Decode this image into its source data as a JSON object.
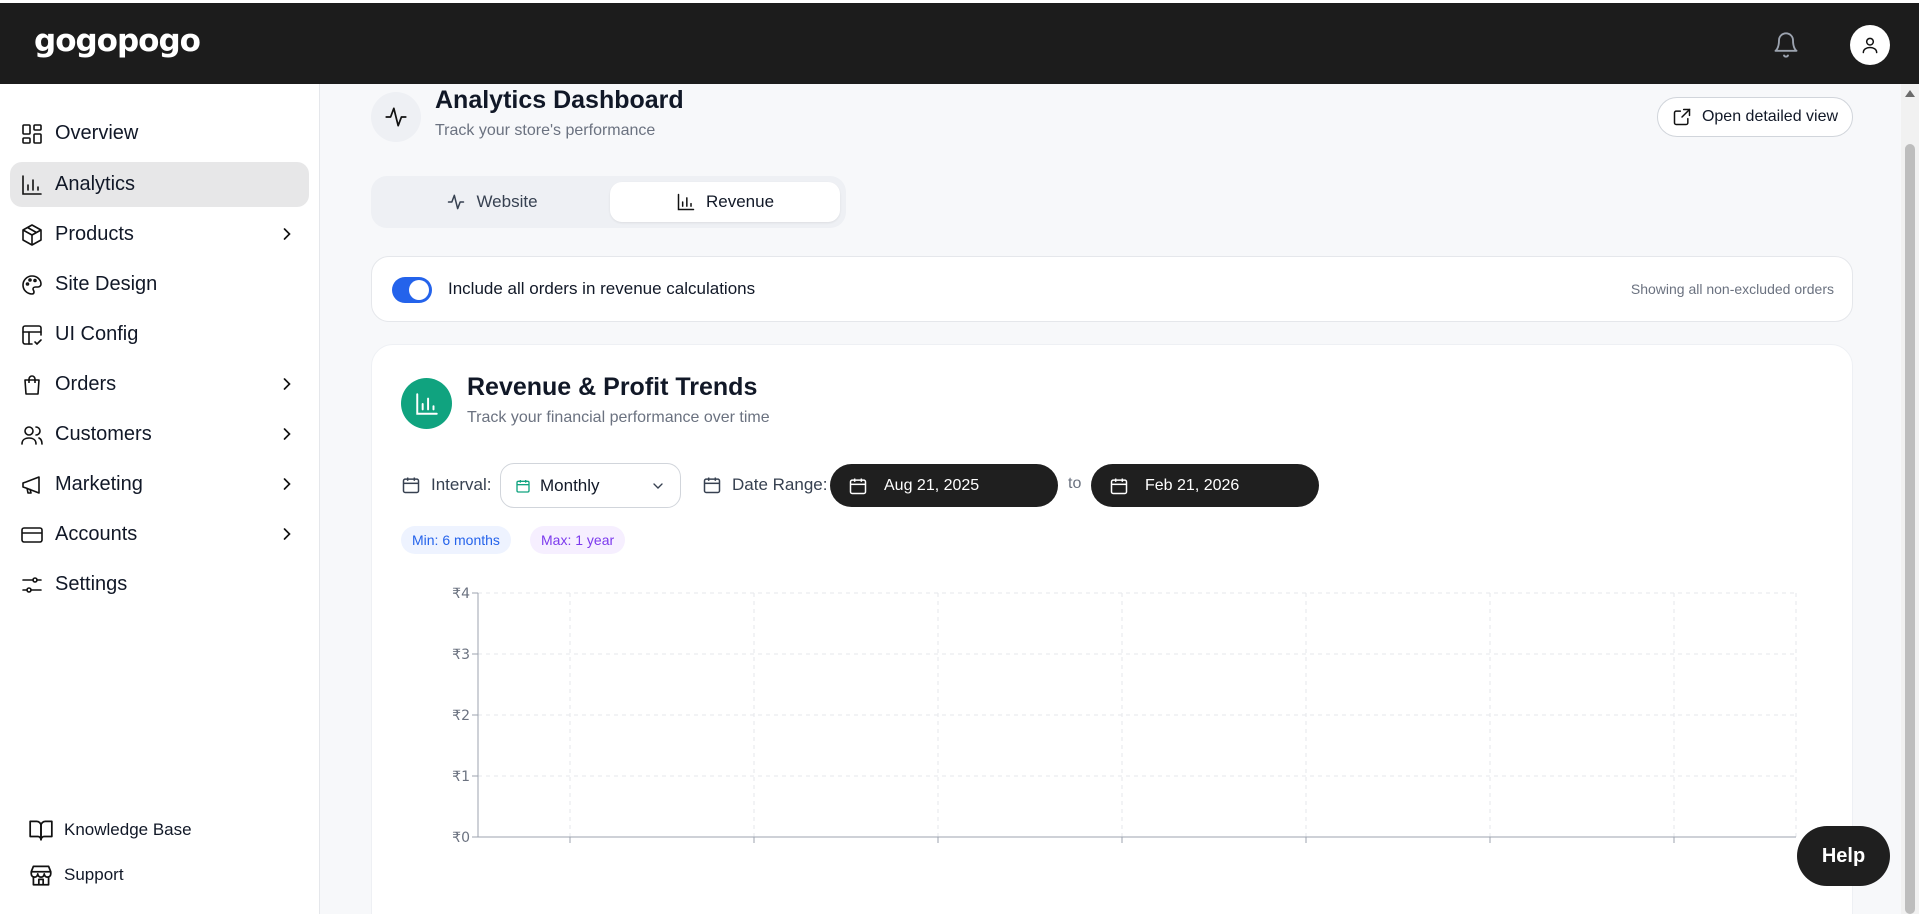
{
  "app": {
    "logo": "gogopogo"
  },
  "topbar": {
    "bell_icon": "bell-icon",
    "avatar_icon": "user-icon"
  },
  "sidebar": {
    "items": [
      {
        "label": "Overview",
        "icon": "layout-grid-icon",
        "has_submenu": false,
        "active": false
      },
      {
        "label": "Analytics",
        "icon": "bar-chart-icon",
        "has_submenu": false,
        "active": true
      },
      {
        "label": "Products",
        "icon": "box-icon",
        "has_submenu": true,
        "active": false
      },
      {
        "label": "Site Design",
        "icon": "palette-icon",
        "has_submenu": false,
        "active": false
      },
      {
        "label": "UI Config",
        "icon": "layout-check-icon",
        "has_submenu": false,
        "active": false
      },
      {
        "label": "Orders",
        "icon": "shopping-bag-icon",
        "has_submenu": true,
        "active": false
      },
      {
        "label": "Customers",
        "icon": "users-icon",
        "has_submenu": true,
        "active": false
      },
      {
        "label": "Marketing",
        "icon": "megaphone-icon",
        "has_submenu": true,
        "active": false
      },
      {
        "label": "Accounts",
        "icon": "credit-card-icon",
        "has_submenu": true,
        "active": false
      },
      {
        "label": "Settings",
        "icon": "sliders-icon",
        "has_submenu": false,
        "active": false
      }
    ],
    "footer": [
      {
        "label": "Knowledge Base",
        "icon": "book-open-icon"
      },
      {
        "label": "Support",
        "icon": "store-icon"
      }
    ]
  },
  "header": {
    "title": "Analytics Dashboard",
    "subtitle": "Track your store's performance",
    "detail_button": "Open detailed view"
  },
  "tabs": [
    {
      "label": "Website",
      "icon": "activity-icon",
      "active": false
    },
    {
      "label": "Revenue",
      "icon": "bar-chart-icon",
      "active": true
    }
  ],
  "toggle": {
    "label": "Include all orders in revenue calculations",
    "on": true,
    "note": "Showing all non-excluded orders"
  },
  "revenue_card": {
    "title": "Revenue & Profit Trends",
    "subtitle": "Track your financial performance over time",
    "interval_label": "Interval:",
    "interval_value": "Monthly",
    "date_range_label": "Date Range:",
    "date_from": "Aug 21, 2025",
    "date_to": "Feb 21, 2026",
    "to_label": "to",
    "min_chip": "Min: 6 months",
    "max_chip": "Max: 1 year"
  },
  "help": {
    "label": "Help"
  },
  "colors": {
    "accent": "#2463eb",
    "brand_green": "#10a37f",
    "dark": "#1f1f1f"
  },
  "chart_data": {
    "type": "line",
    "y_ticks": [
      "₹0",
      "₹1",
      "₹2",
      "₹3",
      "₹4"
    ],
    "ylim": [
      0,
      4
    ],
    "x_tick_count": 7,
    "series": [],
    "grid": true
  }
}
